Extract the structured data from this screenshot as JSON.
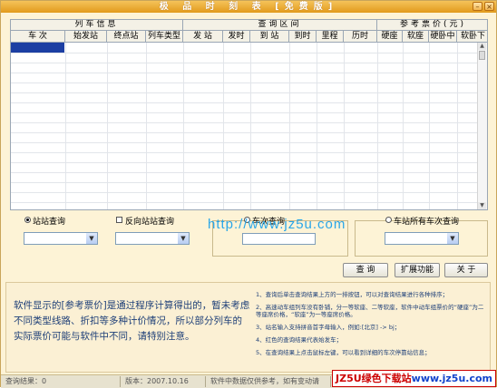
{
  "window": {
    "title": "极 品 时 刻 表 [免费版]",
    "minimize_glyph": "–",
    "close_glyph": "×"
  },
  "grid": {
    "groups": [
      "列车信息",
      "查询区间",
      "参考票价(元)"
    ],
    "columns": [
      "车 次",
      "始发站",
      "终点站",
      "列车类型",
      "发 站",
      "发时",
      "到 站",
      "到时",
      "里程",
      "历时",
      "硬座",
      "软座",
      "硬卧中",
      "软卧下"
    ]
  },
  "query": {
    "station_query": "站站查询",
    "reverse_query": "反向站站查询",
    "train_query": "车次查询",
    "station_all_query": "车站所有车次查询",
    "watermark": "http://www.jz5u.com"
  },
  "buttons": {
    "query": "查 询",
    "extend": "扩展功能",
    "about": "关 于"
  },
  "note": {
    "main": "软件显示的[参考票价]是通过程序计算得出的，暂未考虑不同类型线路、折扣等多种计价情况，所以部分列车的实际票价可能与软件中不同，请特别注意。",
    "items": [
      "1、查询后单击查询结果上方的一排按钮，可以对查询结果进行各种排序；",
      "2、高速动车组列车没有卧铺，分一等软座、二等软座，软件中动车组票价的“硬座”为二等座席价格，“软座”为一等座席价格。",
      "3、站名输入支持拼音首字母输入，例如:[北京] -> bj；",
      "4、红色的查询结果代表始发车；",
      "5、在查询结果上点击鼠标左键，可以看到详细的车次停靠站信息；"
    ]
  },
  "status": {
    "result": "查询结果：0",
    "version": "版本：2007.10.16",
    "notice": "软件中数据仅供参考，如有变动请"
  },
  "brand": {
    "part1": "JZ5U绿色下载站",
    "part2": "www.jz5u.com"
  }
}
